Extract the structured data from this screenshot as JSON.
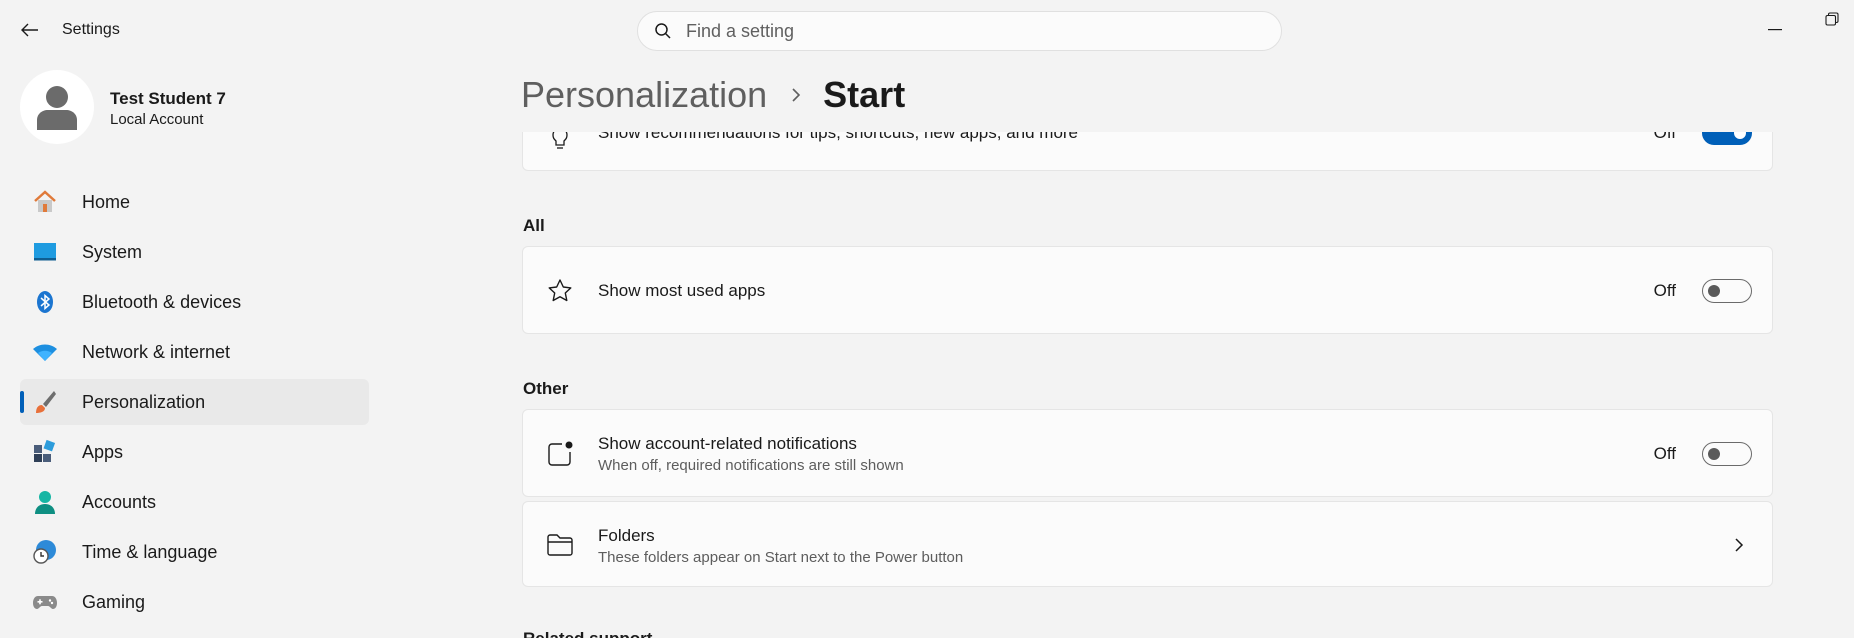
{
  "window": {
    "app_title": "Settings",
    "back_icon": "arrow-left-icon",
    "minimize_icon": "minimize-icon",
    "restore_icon": "restore-icon"
  },
  "search": {
    "placeholder": "Find a setting",
    "value": "",
    "icon": "search-icon"
  },
  "user": {
    "name": "Test Student 7",
    "account_type": "Local Account"
  },
  "sidebar": {
    "items": [
      {
        "label": "Home",
        "icon": "home-icon",
        "active": false
      },
      {
        "label": "System",
        "icon": "display-icon",
        "active": false
      },
      {
        "label": "Bluetooth & devices",
        "icon": "bluetooth-icon",
        "active": false
      },
      {
        "label": "Network & internet",
        "icon": "wifi-icon",
        "active": false
      },
      {
        "label": "Personalization",
        "icon": "brush-icon",
        "active": true
      },
      {
        "label": "Apps",
        "icon": "apps-icon",
        "active": false
      },
      {
        "label": "Accounts",
        "icon": "person-icon",
        "active": false
      },
      {
        "label": "Time & language",
        "icon": "globe-clock-icon",
        "active": false
      },
      {
        "label": "Gaming",
        "icon": "gamepad-icon",
        "active": false
      }
    ]
  },
  "header": {
    "parent": "Personalization",
    "current": "Start"
  },
  "content": {
    "recommendations": {
      "title": "Show recommendations for tips, shortcuts, new apps, and more",
      "state": "Off",
      "toggle_on": true,
      "icon": "lightbulb-icon"
    },
    "section_all": "All",
    "most_used": {
      "title": "Show most used apps",
      "state": "Off",
      "toggle_on": false,
      "icon": "star-icon"
    },
    "section_other": "Other",
    "account_notifications": {
      "title": "Show account-related notifications",
      "subtitle": "When off, required notifications are still shown",
      "state": "Off",
      "toggle_on": false,
      "icon": "notification-badge-icon"
    },
    "folders": {
      "title": "Folders",
      "subtitle": "These folders appear on Start next to the Power button",
      "icon": "folder-icon",
      "chevron": "chevron-right-icon"
    },
    "related_support": "Related support"
  },
  "colors": {
    "accent": "#005fb8",
    "background": "#f3f3f3",
    "card": "#fbfbfb"
  }
}
